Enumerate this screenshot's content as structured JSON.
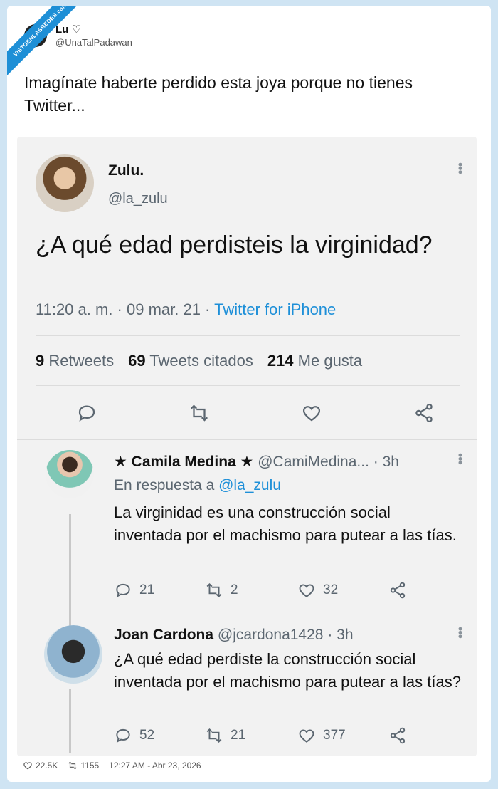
{
  "watermark": "VISTOENLASREDES.com",
  "outer": {
    "name": "Lu ♡",
    "handle": "@UnaTalPadawan",
    "text": "Imagínate haberte perdido esta joya porque no tienes Twitter..."
  },
  "quoted": {
    "name": "Zulu.",
    "handle": "@la_zulu",
    "text": "¿A qué edad perdisteis la virginidad?",
    "time": "11:20 a. m. · 09 mar. 21 · ",
    "source": "Twitter for iPhone",
    "stats": {
      "retweets_count": "9",
      "retweets_label": "Retweets",
      "quotes_count": "69",
      "quotes_label": "Tweets citados",
      "likes_count": "214",
      "likes_label": "Me gusta"
    }
  },
  "replies": [
    {
      "name": "★ Camila Medina ★",
      "handle": "@CamiMedina...",
      "time": "· 3h",
      "in_reply_prefix": "En respuesta a ",
      "in_reply_handle": "@la_zulu",
      "text": "La virginidad es una construcción social inventada por el machismo para putear a las tías.",
      "replies": "21",
      "retweets": "2",
      "likes": "32"
    },
    {
      "name": "Joan Cardona",
      "handle": "@jcardona1428",
      "time": "· 3h",
      "text": "¿A qué edad perdiste la construcción social inventada por el machismo para putear a las tías?",
      "replies": "52",
      "retweets": "21",
      "likes": "377"
    }
  ],
  "footer": {
    "likes": "22.5K",
    "retweets": "1155",
    "timestamp": "12:27 AM - Abr 23, 2026"
  },
  "colors": {
    "link": "#1d8fd8",
    "background": "#cfe4f3"
  }
}
